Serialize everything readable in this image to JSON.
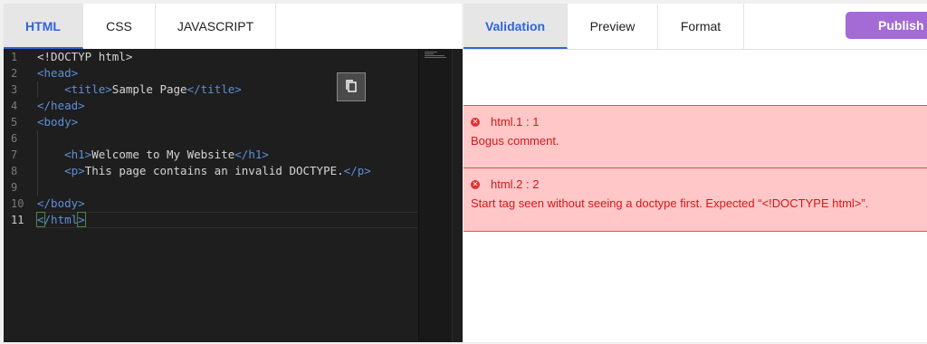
{
  "editor_tabs": [
    "HTML",
    "CSS",
    "JAVASCRIPT"
  ],
  "code_lines": [
    {
      "num": "1",
      "html": "&lt;!DOCTYP html&gt;"
    },
    {
      "num": "2",
      "html": "<span class=\"tag\">&lt;head&gt;</span>"
    },
    {
      "num": "3",
      "html": "    <span class=\"tag\">&lt;title&gt;</span>Sample Page<span class=\"tag\">&lt;/title&gt;</span>"
    },
    {
      "num": "4",
      "html": "<span class=\"tag\">&lt;/head&gt;</span>"
    },
    {
      "num": "5",
      "html": "<span class=\"tag\">&lt;body&gt;</span>"
    },
    {
      "num": "6",
      "html": ""
    },
    {
      "num": "7",
      "html": "    <span class=\"tag\">&lt;h1&gt;</span>Welcome to My Website<span class=\"tag\">&lt;/h1&gt;</span>"
    },
    {
      "num": "8",
      "html": "    <span class=\"tag\">&lt;p&gt;</span>This page contains an invalid DOCTYPE.<span class=\"tag\">&lt;/p&gt;</span>"
    },
    {
      "num": "9",
      "html": ""
    },
    {
      "num": "10",
      "html": "<span class=\"tag\">&lt;/body&gt;</span>"
    },
    {
      "num": "11",
      "html": "<span class=\"tag\"><span class=\"bracket\">&lt;</span>/html<span class=\"bracket\">&gt;</span></span>"
    }
  ],
  "result_tabs": [
    "Validation",
    "Preview",
    "Format"
  ],
  "publish_label": "Publish",
  "errors": [
    {
      "location": "html.1 : 1",
      "message": "Bogus comment."
    },
    {
      "location": "html.2 : 2",
      "message": "Start tag seen without seeing a doctype first. Expected “<!DOCTYPE html>”."
    }
  ],
  "colors": {
    "accent": "#2f66d8",
    "publish": "#a46bd4",
    "error_bg": "#ffc7c7",
    "error_text": "#d11a1a"
  }
}
